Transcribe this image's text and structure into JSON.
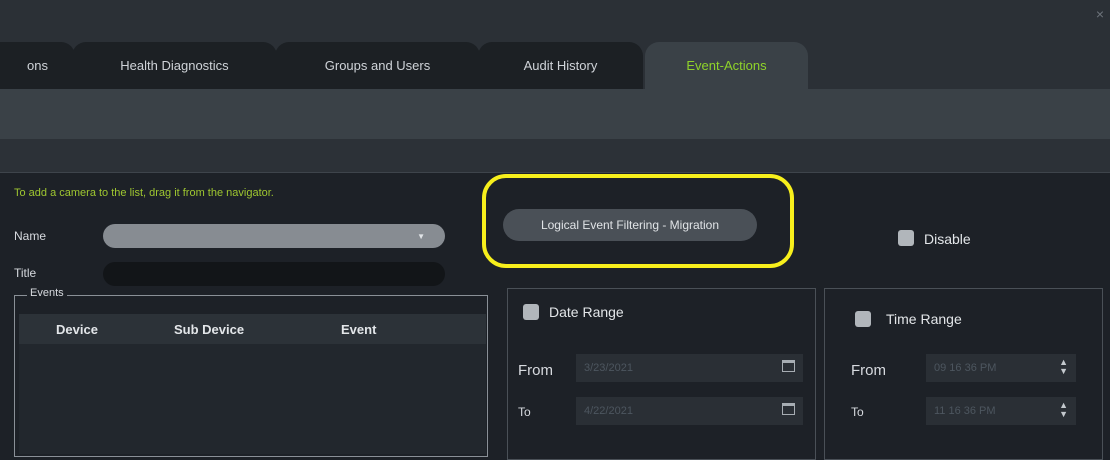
{
  "window": {
    "close_glyph": "×"
  },
  "tabs": [
    {
      "label": "ons",
      "active": false
    },
    {
      "label": "Health Diagnostics",
      "active": false
    },
    {
      "label": "Groups and Users",
      "active": false
    },
    {
      "label": "Audit History",
      "active": false
    },
    {
      "label": "Event-Actions",
      "active": true
    }
  ],
  "form": {
    "hint": "To add a camera to the list, drag it from the navigator.",
    "name_label": "Name",
    "title_label": "Title",
    "name_value": "",
    "title_value": "",
    "events_legend": "Events",
    "events_columns": [
      "Device",
      "Sub Device",
      "Event"
    ]
  },
  "action": {
    "selected_label": "Logical Event Filtering - Migration",
    "highlight_color": "#f7ef1c",
    "disable_label": "Disable"
  },
  "date_range": {
    "label": "Date Range",
    "from_label": "From",
    "to_label": "To",
    "from_value": "3/23/2021",
    "to_value": "4/22/2021"
  },
  "time_range": {
    "label": "Time Range",
    "from_label": "From",
    "to_label": "To",
    "from_value": "09  16  36 PM",
    "to_value": "11  16  36 PM"
  },
  "colors": {
    "accent_green": "#8fd32a",
    "hint_green": "#9fc730",
    "background": "#1d2127"
  },
  "icons": [
    "close-icon",
    "dropdown-arrow-icon",
    "calendar-icon",
    "spinner-icon",
    "checkbox-icon"
  ]
}
